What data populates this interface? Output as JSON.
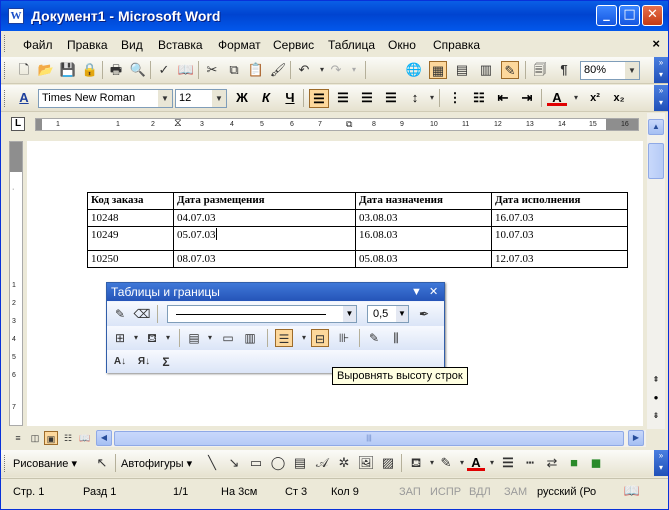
{
  "window": {
    "title": "Документ1 - Microsoft Word",
    "app_icon": "word-doc-icon",
    "controls": [
      "minimize-icon",
      "maximize-icon",
      "close-icon"
    ]
  },
  "menu": {
    "items": [
      "Файл",
      "Правка",
      "Вид",
      "Вставка",
      "Формат",
      "Сервис",
      "Таблица",
      "Окно",
      "Справка"
    ],
    "close_glyph": "×"
  },
  "toolbar_standard": {
    "zoom": "80%"
  },
  "toolbar_formatting": {
    "style_glyph": "A",
    "font": "Times New Roman",
    "size": "12",
    "bold": "Ж",
    "italic": "К",
    "underline": "Ч",
    "font_color_glyph": "A",
    "superscript": "x²",
    "subscript": "x₂",
    "align_active": "align-left"
  },
  "ruler": {
    "corner_glyph": "L",
    "ticks": [
      "1",
      "1",
      "2",
      "3",
      "4",
      "5",
      "6",
      "7",
      "8",
      "9",
      "10",
      "11",
      "12",
      "13",
      "14",
      "15",
      "16",
      "17"
    ],
    "vertical_ticks": [
      "1",
      "2",
      "3",
      "4",
      "5",
      "6",
      "7"
    ]
  },
  "table": {
    "headers": [
      "Код заказа",
      "Дата размещения",
      "Дата назначения",
      "Дата исполнения"
    ],
    "rows": [
      [
        "10248",
        "04.07.03",
        "03.08.03",
        "16.07.03"
      ],
      [
        "10249",
        "05.07.03",
        "16.08.03",
        "10.07.03"
      ],
      [
        "10250",
        "08.07.03",
        "05.08.03",
        "12.07.03"
      ]
    ]
  },
  "tables_toolbar": {
    "title": "Таблицы и границы",
    "line_weight": "0,5",
    "sigma": "Σ",
    "active_tool": "distribute-rows-icon"
  },
  "tooltip": "Выровнять высоту строк",
  "drawing": {
    "draw_label": "Рисование",
    "autoshapes_label": "Автофигуры"
  },
  "status": {
    "page": "Стр. 1",
    "section": "Разд 1",
    "pages": "1/1",
    "at": "На 3см",
    "line": "Ст 3",
    "col": "Кол 9",
    "rec": "ЗАП",
    "trk": "ИСПР",
    "ext": "ВДЛ",
    "ovr": "ЗАМ",
    "lang": "русский (Ро"
  },
  "colors": {
    "title_bar": "#0A5FE6",
    "chrome": "#ECE9D8",
    "panel_title": "#2554B8",
    "tooltip_bg": "#FFFFE1",
    "active_button": "#FDD89C"
  }
}
